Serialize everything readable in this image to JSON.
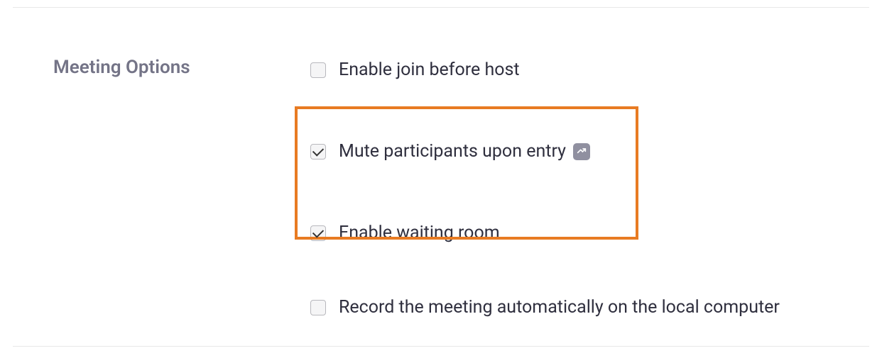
{
  "section": {
    "title": "Meeting Options"
  },
  "options": {
    "join_before_host": {
      "label": "Enable join before host",
      "checked": false
    },
    "mute_on_entry": {
      "label": "Mute participants upon entry",
      "checked": true,
      "has_info": true
    },
    "waiting_room": {
      "label": "Enable waiting room",
      "checked": true
    },
    "record_auto": {
      "label": "Record the meeting automatically on the local computer",
      "checked": false
    }
  }
}
